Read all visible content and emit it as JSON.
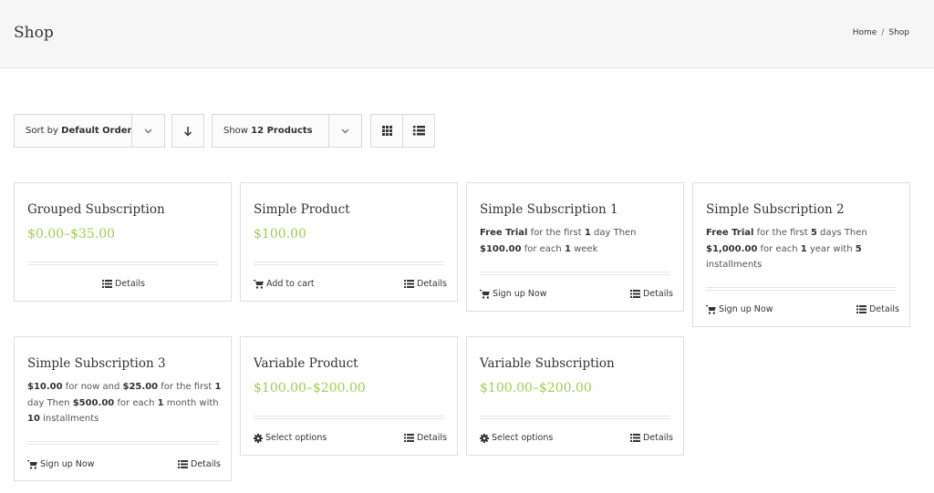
{
  "header": {
    "title": "Shop",
    "breadcrumb": [
      "Home",
      "Shop"
    ],
    "breadcrumb_sep": "/"
  },
  "toolbar": {
    "sort_prefix": "Sort by",
    "sort_value": "Default Order",
    "show_prefix": "Show",
    "show_value": "12 Products"
  },
  "products": [
    {
      "title": "Grouped Subscription",
      "price": "$0.00–$35.00",
      "details_label": "Details"
    },
    {
      "title": "Simple Product",
      "price": "$100.00",
      "action_label": "Add to cart",
      "details_label": "Details"
    },
    {
      "title": "Simple Subscription 1",
      "desc": {
        "a": "Free Trial",
        "b": " for the first ",
        "c": "1",
        "d": " day Then ",
        "e": "$100.00",
        "f": " for each ",
        "g": "1",
        "h": " week"
      },
      "action_label": "Sign up Now",
      "details_label": "Details"
    },
    {
      "title": "Simple Subscription 2",
      "desc": {
        "a": "Free Trial",
        "b": " for the first ",
        "c": "5",
        "d": " days Then ",
        "e": "$1,000.00",
        "f": " for each ",
        "g": "1",
        "h": " year with ",
        "i": "5",
        "j": " installments"
      },
      "action_label": "Sign up Now",
      "details_label": "Details"
    },
    {
      "title": "Simple Subscription 3",
      "desc": {
        "a": "$10.00",
        "b": " for now and ",
        "c": "$25.00",
        "d": " for the first ",
        "e": "1",
        "f": " day Then ",
        "g": "$500.00",
        "h": " for each ",
        "i": "1",
        "j": " month with ",
        "k": "10",
        "l": " installments"
      },
      "action_label": "Sign up Now",
      "details_label": "Details"
    },
    {
      "title": "Variable Product",
      "price": "$100.00–$200.00",
      "action_label": "Select options",
      "details_label": "Details"
    },
    {
      "title": "Variable Subscription",
      "price": "$100.00–$200.00",
      "action_label": "Select options",
      "details_label": "Details"
    }
  ],
  "colors": {
    "price": "#a0ce4e",
    "header_bg": "#f6f6f6"
  },
  "icons": {
    "cart": "cart-icon",
    "list": "list-icon",
    "gear": "gear-icon",
    "grid": "grid-view-icon",
    "sort_direction": "arrow-down-icon",
    "dropdown": "chevron-down-icon"
  }
}
